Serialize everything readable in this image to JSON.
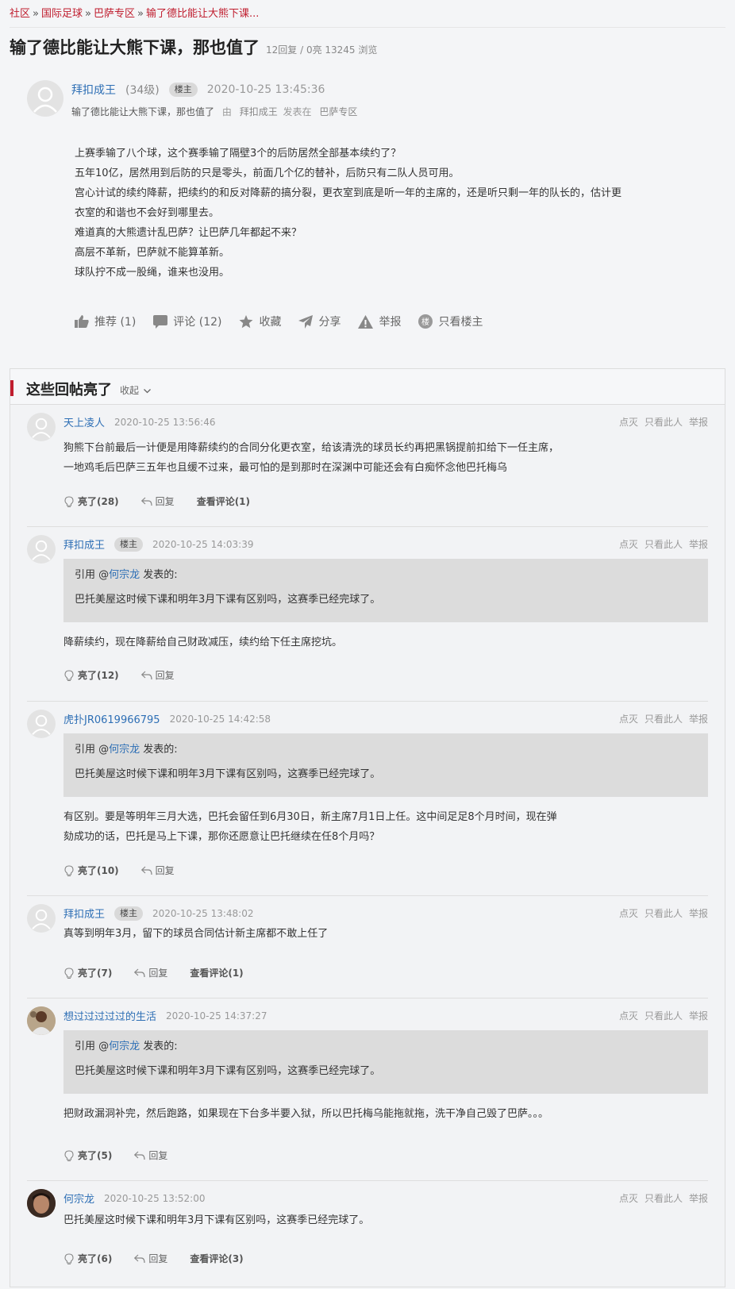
{
  "breadcrumb": [
    "社区",
    "国际足球",
    "巴萨专区",
    "输了德比能让大熊下课..."
  ],
  "breadcrumb_sep": "»",
  "thread": {
    "title": "输了德比能让大熊下课，那也值了",
    "stats": "12回复 / 0亮 13245 浏览"
  },
  "op": {
    "username": "拜扣成王",
    "level": "(34级)",
    "badge": "楼主",
    "time": "2020-10-25 13:45:36",
    "subtitle": "输了德比能让大熊下课，那也值了",
    "by": "由",
    "author": "拜扣成王",
    "posted_in": "发表在",
    "forum": "巴萨专区",
    "body": [
      "上赛季输了八个球，这个赛季输了隔壁3个的后防居然全部基本续约了？",
      "五年10亿，居然用到后防的只是零头，前面几个亿的替补，后防只有二队人员可用。",
      "宫心计试的续约降薪，把续约的和反对降薪的搞分裂，更衣室到底是听一年的主席的，还是听只剩一年的队长的，估计更",
      "衣室的和谐也不会好到哪里去。",
      "难道真的大熊遗计乱巴萨？让巴萨几年都起不来？",
      "高层不革新，巴萨就不能算革新。",
      "球队拧不成一股绳，谁来也没用。"
    ],
    "actions": {
      "recommend": "推荐 (1)",
      "comment": "评论 (12)",
      "favorite": "收藏",
      "share": "分享",
      "report": "举报",
      "only_op": "只看楼主",
      "only_op_glyph": "楼"
    }
  },
  "highlights": {
    "title": "这些回帖亮了",
    "fold": "收起",
    "ops": [
      "点灭",
      "只看此人",
      "举报"
    ],
    "reply_label": "回复",
    "quote_prefix": "引用 @",
    "quote_suffix": " 发表的:",
    "replies": [
      {
        "user": "天上凌人",
        "badge": "",
        "time": "2020-10-25 13:56:46",
        "quote_user": "",
        "quote_text": "",
        "text": [
          "狗熊下台前最后一计便是用降薪续约的合同分化更衣室，给该清洗的球员长约再把黑锅提前扣给下一任主席，",
          "一地鸡毛后巴萨三五年也且缓不过来，最可怕的是到那时在深渊中可能还会有白痴怀念他巴托梅乌"
        ],
        "light": "亮了(28)",
        "comments": "查看评论(1)"
      },
      {
        "user": "拜扣成王",
        "badge": "楼主",
        "time": "2020-10-25 14:03:39",
        "quote_user": "何宗龙",
        "quote_text": "巴托美屋这时候下课和明年3月下课有区别吗，这赛季已经完球了。",
        "text": [
          "降薪续约，现在降薪给自己财政减压，续约给下任主席挖坑。"
        ],
        "light": "亮了(12)",
        "comments": ""
      },
      {
        "user": "虎扑JR0619966795",
        "badge": "",
        "time": "2020-10-25 14:42:58",
        "quote_user": "何宗龙",
        "quote_text": "巴托美屋这时候下课和明年3月下课有区别吗，这赛季已经完球了。",
        "text": [
          "有区别。要是等明年三月大选，巴托会留任到6月30日，新主席7月1日上任。这中间足足8个月时间，现在弹",
          "劾成功的话，巴托是马上下课，那你还愿意让巴托继续在任8个月吗？"
        ],
        "light": "亮了(10)",
        "comments": ""
      },
      {
        "user": "拜扣成王",
        "badge": "楼主",
        "time": "2020-10-25 13:48:02",
        "quote_user": "",
        "quote_text": "",
        "text": [
          "真等到明年3月，留下的球员合同估计新主席都不敢上任了"
        ],
        "light": "亮了(7)",
        "comments": "查看评论(1)"
      },
      {
        "user": "想过过过过过的生活",
        "badge": "",
        "time": "2020-10-25 14:37:27",
        "quote_user": "何宗龙",
        "quote_text": "巴托美屋这时候下课和明年3月下课有区别吗，这赛季已经完球了。",
        "text": [
          "把财政漏洞补完，然后跑路，如果现在下台多半要入狱，所以巴托梅乌能拖就拖，洗干净自己毁了巴萨。。。"
        ],
        "light": "亮了(5)",
        "comments": ""
      },
      {
        "user": "何宗龙",
        "badge": "",
        "time": "2020-10-25 13:52:00",
        "quote_user": "",
        "quote_text": "",
        "text": [
          "巴托美屋这时候下课和明年3月下课有区别吗，这赛季已经完球了。"
        ],
        "light": "亮了(6)",
        "comments": "查看评论(3)"
      }
    ]
  }
}
